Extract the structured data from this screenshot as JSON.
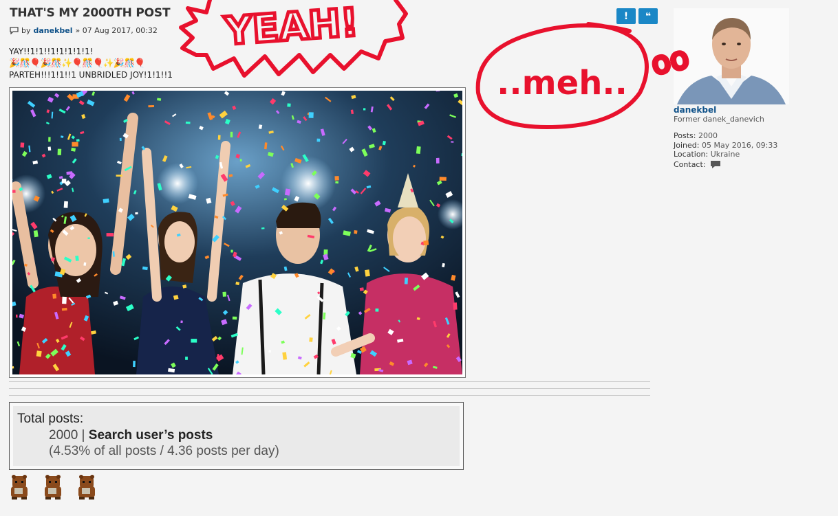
{
  "post": {
    "title": "THAT'S MY 2000TH POST",
    "by_label": "by",
    "author": "danekbel",
    "date": "» 07 Aug 2017, 00:32",
    "text_line1": "YAY!!1!1!!1!1!1!1!1!",
    "emojis": [
      "🎉",
      "🎊",
      "🎈",
      "🎉",
      "🎊",
      "✨",
      "🎈",
      "🎊",
      "🎈",
      "✨",
      "🎉",
      "🎊",
      "🎈"
    ],
    "text_line3": "PARTEH!!!1!1!!1 UNBRIDLED JOY!1!1!!1"
  },
  "actions": {
    "report": "!",
    "quote": "❝"
  },
  "annotations": {
    "yeah": "YEAH!",
    "meh": "..meh..",
    "oo": "oo"
  },
  "stats": {
    "label": "Total posts:",
    "count": "2000",
    "separator": " | ",
    "search_label": "Search user’s posts",
    "detail": "(4.53% of all posts / 4.36 posts per day)"
  },
  "profile": {
    "name": "danekbel",
    "rank": "Former danek_danevich",
    "posts_label": "Posts:",
    "posts_value": "2000",
    "joined_label": "Joined:",
    "joined_value": "05 May 2016, 09:33",
    "location_label": "Location:",
    "location_value": "Ukraine",
    "contact_label": "Contact:"
  },
  "icons": [
    "post-icon",
    "report-icon",
    "quote-icon",
    "contact-icon",
    "bear-rank-icon"
  ]
}
